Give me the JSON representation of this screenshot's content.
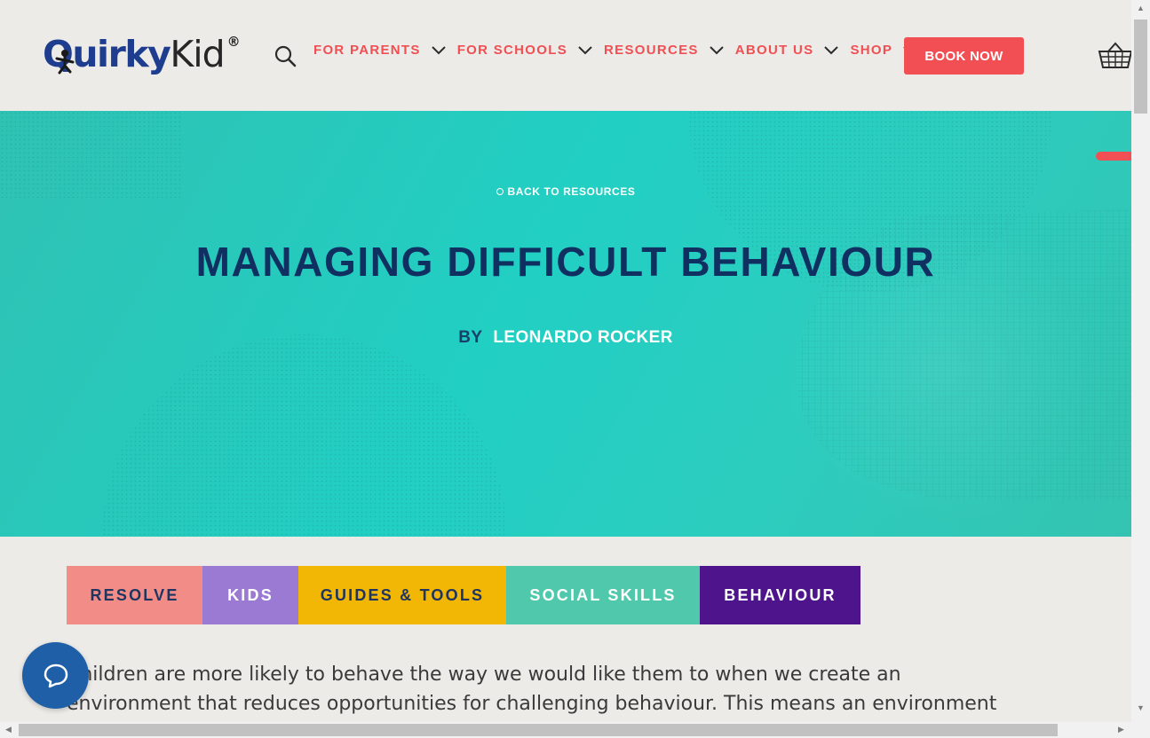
{
  "header": {
    "logo": {
      "part1": "Quirky",
      "part2": "Kid",
      "mark": "®"
    },
    "search_icon": "search-icon",
    "nav": [
      {
        "label": "FOR PARENTS"
      },
      {
        "label": "FOR SCHOOLS"
      },
      {
        "label": "RESOURCES"
      },
      {
        "label": "ABOUT US"
      },
      {
        "label": "SHOP"
      }
    ],
    "book_label": "BOOK NOW",
    "cart_icon": "basket-icon"
  },
  "hero": {
    "back_label": "BACK TO RESOURCES",
    "title": "MANAGING DIFFICULT BEHAVIOUR",
    "by_label": "BY",
    "author": "LEONARDO ROCKER"
  },
  "tags": [
    {
      "label": "RESOLVE",
      "bg": "#f28c87",
      "fg": "#1f3560"
    },
    {
      "label": "KIDS",
      "bg": "#9a7ad3",
      "fg": "#ffffff"
    },
    {
      "label": "GUIDES & TOOLS",
      "bg": "#f2b705",
      "fg": "#1f3560"
    },
    {
      "label": "SOCIAL SKILLS",
      "bg": "#4fc8ab",
      "fg": "#ffffff"
    },
    {
      "label": "BEHAVIOUR",
      "bg": "#4d148c",
      "fg": "#ffffff"
    }
  ],
  "article": {
    "line1": "Children are more likely to behave the way we would like them to when we create an",
    "line2": "environment that reduces opportunities for challenging behaviour. This means an environment"
  },
  "colors": {
    "brand_blue": "#1e3d8f",
    "accent_red": "#f24f55",
    "hero_teal": "#21cfc3",
    "title_navy": "#0f3060"
  }
}
